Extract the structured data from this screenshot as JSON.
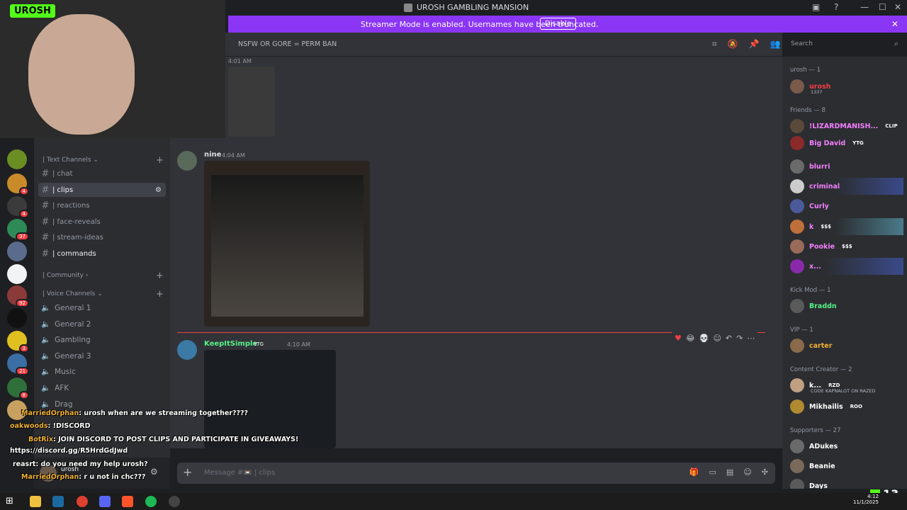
{
  "window": {
    "title": "UROSH GAMBLING MANSION"
  },
  "banner": {
    "text": "Streamer Mode is enabled. Usernames have been truncated.",
    "button": "Disable"
  },
  "header": {
    "topic": "NSFW OR GORE = PERM BAN"
  },
  "search": {
    "placeholder": "Search"
  },
  "server_badges": [
    "4",
    "4",
    "37",
    "92",
    "21",
    "8",
    "3"
  ],
  "channels": {
    "text_category": "| Text Channels",
    "items": [
      {
        "label": "| chat"
      },
      {
        "label": "| clips"
      },
      {
        "label": "| reactions"
      },
      {
        "label": "| face-reveals"
      },
      {
        "label": "| stream-ideas"
      },
      {
        "label": "| commands"
      }
    ],
    "community_category": "| Community",
    "voice_category": "| Voice Channels",
    "voice": [
      "General 1",
      "General 2",
      "Gambling",
      "General 3",
      "Music",
      "AFK",
      "Drag"
    ]
  },
  "messages": {
    "top_time": "4:01 AM",
    "m1": {
      "author": "nine",
      "time": "4:04 AM"
    },
    "m2": {
      "author": "KeepItSimple",
      "tag": "YTG",
      "time": "4:10 AM"
    }
  },
  "composer": {
    "placeholder": "Message #📼 | clips"
  },
  "members": {
    "urosh_head": "urosh — 1",
    "urosh": {
      "name": "urosh",
      "sub": "1337"
    },
    "friends_head": "Friends — 8",
    "friends": [
      {
        "name": "!LIZARDMANISH...",
        "tag": "CLIP",
        "color": "#f47fff"
      },
      {
        "name": "Big David",
        "tag": "YTG",
        "color": "#f47fff"
      },
      {
        "name": "blurri",
        "tag": "",
        "color": "#f47fff"
      },
      {
        "name": "criminal",
        "tag": "",
        "color": "#f47fff"
      },
      {
        "name": "Curly",
        "tag": "",
        "color": "#f47fff"
      },
      {
        "name": "k",
        "tag": "$$$",
        "color": "#f47fff"
      },
      {
        "name": "Pookie",
        "tag": "$$$",
        "color": "#f47fff"
      },
      {
        "name": "x...",
        "tag": "",
        "color": "#f47fff"
      }
    ],
    "kickmod_head": "Kick Mod — 1",
    "kickmod": {
      "name": "Braddn",
      "color": "#57f287"
    },
    "vip_head": "VIP — 1",
    "vip": {
      "name": "carter",
      "color": "#f0b232"
    },
    "cc_head": "Content Creator — 2",
    "cc": [
      {
        "name": "k...",
        "tag": "RZD",
        "sub": "CODE KAPNALOT ON RAZED",
        "color": "#ffffff"
      },
      {
        "name": "Mikhailis",
        "tag": "ROO",
        "sub": "",
        "color": "#ffffff"
      }
    ],
    "sup_head": "Supporters — 27",
    "sup": [
      {
        "name": "ADukes",
        "color": "#ffffff"
      },
      {
        "name": "Beanie",
        "color": "#ffffff"
      },
      {
        "name": "Days",
        "color": "#ffffff"
      }
    ]
  },
  "user_panel": {
    "name": "urosh"
  },
  "overlay_chat": [
    {
      "user": "MarriedOrphan",
      "text": ": urosh when are we streaming together????",
      "color": "#f0b232"
    },
    {
      "user": "oakwoods",
      "text": ": !DISCORD",
      "color": "#f0b232"
    },
    {
      "user": "BotRix",
      "text": ": JOIN DISCORD TO POST CLIPS AND PARTICIPATE IN GIVEAWAYS!",
      "color": "#f0b232"
    },
    {
      "user": "",
      "text": "https://discord.gg/R5HrdGdJwd",
      "color": "#ffffff"
    },
    {
      "user": "reasrt",
      "text": ": do you need my help urosh?",
      "color": "#ffffff"
    },
    {
      "user": "MarriedOrphan",
      "text": ": r u not in chc???",
      "color": "#f0b232"
    }
  ],
  "stream": {
    "logo_text": "UROSH",
    "viewer_count": "13"
  },
  "clock": {
    "time": "4:12",
    "date": "11/1/2025"
  }
}
